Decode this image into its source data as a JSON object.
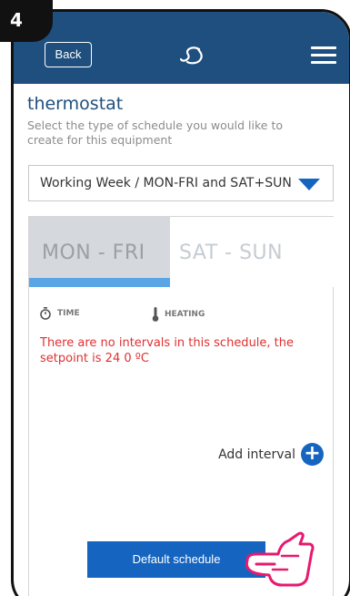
{
  "step": {
    "number": "4"
  },
  "header": {
    "back_label": "Back",
    "logo_icon": "salus-logo-icon",
    "menu_icon": "hamburger-menu-icon",
    "bg_color": "#1f4f7e"
  },
  "page": {
    "title": "thermostat",
    "subtitle": "Select the type of schedule you would like to create for this equipment"
  },
  "schedule_select": {
    "value": "Working Week / MON-FRI and SAT+SUN",
    "arrow_icon": "dropdown-triangle-icon"
  },
  "tabs": [
    {
      "label": "MON - FRI",
      "active": true
    },
    {
      "label": "SAT - SUN",
      "active": false
    }
  ],
  "columns": {
    "time": "TIME",
    "heating": "HEATING"
  },
  "empty_message": "There are no intervals in this schedule, the setpoint is 24 0 ºC",
  "add_interval": {
    "label": "Add interval",
    "icon": "plus-circle-icon"
  },
  "default_schedule": {
    "label": "Default schedule"
  },
  "colors": {
    "accent": "#1565c0",
    "error": "#e03030",
    "tab_indicator": "#5aa5e6"
  }
}
